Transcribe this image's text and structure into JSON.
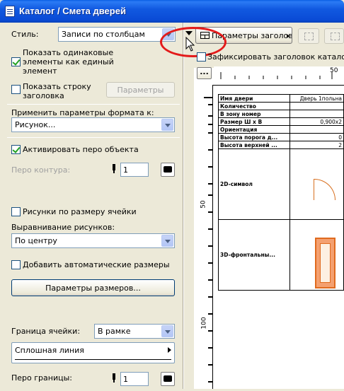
{
  "window": {
    "title": "Каталог / Смета дверей"
  },
  "left": {
    "style_label": "Стиль:",
    "style_value": "Записи по столбцам",
    "show_same_label": "Показать одинаковые элементы как единый элемент",
    "show_same_line1": "Показать одинаковые",
    "show_same_line2": "элементы как единый",
    "show_same_line3": "элемент",
    "show_same_checked": true,
    "show_header_line1": "Показать строку",
    "show_header_line2": "заголовка",
    "show_header_checked": false,
    "params_button": "Параметры",
    "apply_format_label": "Применить параметры формата к:",
    "apply_format_value": "Рисунок...",
    "activate_pen_label": "Активировать перо объекта",
    "activate_pen_checked": true,
    "contour_pen_label": "Перо контура:",
    "contour_pen_value": "1",
    "fit_images_label": "Рисунки по размеру ячейки",
    "fit_images_checked": false,
    "align_images_label": "Выравнивание рисунков:",
    "align_images_value": "По центру",
    "add_auto_dims_label": "Добавить автоматические размеры",
    "add_auto_dims_checked": false,
    "dim_params_button": "Параметры размеров...",
    "cell_border_label": "Граница ячейки:",
    "cell_border_value": "В рамке",
    "line_type_value": "Сплошная линия",
    "border_pen_label": "Перо границы:",
    "border_pen_value": "1"
  },
  "toolbar": {
    "header_params_button": "Параметры заголов...",
    "freeze_header_label": "Зафиксировать заголовок каталога",
    "dots_button": "...",
    "freeze_header_checked": false
  },
  "ruler": {
    "top_label": "50",
    "left_labels": [
      "50",
      "100"
    ]
  },
  "schedule": {
    "rows": [
      {
        "key": "Имя двери",
        "value": "Дверь 1польна"
      },
      {
        "key": "Количество",
        "value": ""
      },
      {
        "key": "В зону номер",
        "value": ""
      },
      {
        "key": "Размер Ш x В",
        "value": "0,900x2"
      },
      {
        "key": "Ориентация",
        "value": ""
      },
      {
        "key": "Высота порога д...",
        "value": "0"
      },
      {
        "key": "Высота верхней ...",
        "value": "2"
      }
    ],
    "symbol_2d": "2D-символ",
    "front_3d": "3D-фронтальны..."
  },
  "colors": {
    "accent": "#0a4bd6",
    "highlight_ellipse": "#e31a1a",
    "door": "#e06a1e"
  }
}
